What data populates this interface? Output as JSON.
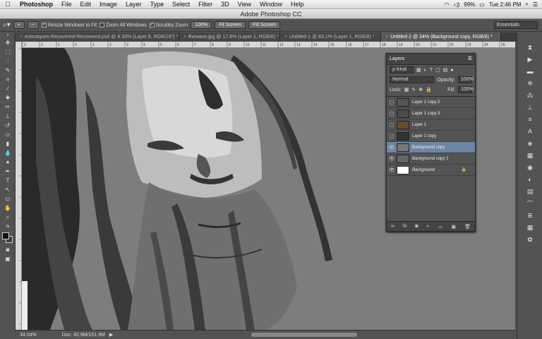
{
  "menubar": {
    "apple": "",
    "app": "Photoshop",
    "items": [
      "File",
      "Edit",
      "Image",
      "Layer",
      "Type",
      "Select",
      "Filter",
      "3D",
      "View",
      "Window",
      "Help"
    ],
    "battery": "99%",
    "clock": "Tue 2:46 PM"
  },
  "window": {
    "title": "Adobe Photoshop CC"
  },
  "options": {
    "resize_label": "Resize Windows to Fit",
    "zoom_all_label": "Zoom All Windows",
    "scrubby_label": "Scrubby Zoom",
    "btn_100": "100%",
    "fit_screen": "Fit Screen",
    "fill_screen": "Fill Screen",
    "workspace": "Essentials"
  },
  "tabs": [
    {
      "label": "estoraques-Recovered-Recovered.psd @ 8.33% (Layer 6, RGB/16*) *"
    },
    {
      "label": "thewave.jpg @ 17.8% (Layer 1, RGB/8) *"
    },
    {
      "label": "Untitled-1 @ 83.1% (Layer 1, RGB/8) *"
    },
    {
      "label": "Untitled-2 @ 34% (Background copy, RGB/8) *"
    }
  ],
  "ruler": {
    "ticks": [
      "3",
      "2",
      "1",
      "0",
      "1",
      "2",
      "3",
      "4",
      "5",
      "6",
      "7",
      "8",
      "9",
      "10",
      "11",
      "12",
      "13",
      "14",
      "15",
      "16",
      "17",
      "18",
      "19",
      "20",
      "21",
      "22",
      "23",
      "24",
      "25"
    ]
  },
  "layers": {
    "title": "Layers",
    "kind": "ρ Kind",
    "blend": "Normal",
    "opacity_label": "Opacity:",
    "opacity": "100%",
    "lock_label": "Lock:",
    "fill_label": "Fill:",
    "fill": "100%",
    "items": [
      {
        "name": "Layer 1 copy 2",
        "visible": false,
        "thumb": "#555"
      },
      {
        "name": "Layer 1 copy 3",
        "visible": false,
        "thumb": "#4a4a4a"
      },
      {
        "name": "Layer 1",
        "visible": false,
        "thumb": "#6b4a2a"
      },
      {
        "name": "Layer 1 copy",
        "visible": false,
        "thumb": "#333"
      },
      {
        "name": "Background copy",
        "visible": true,
        "thumb": "#777",
        "active": true
      },
      {
        "name": "Background copy 2",
        "visible": true,
        "thumb": "#666"
      },
      {
        "name": "Background",
        "visible": true,
        "thumb": "#fff",
        "locked": true
      }
    ]
  },
  "status": {
    "zoom": "34.04%",
    "doc": "Doc: 42.9M/151.9M"
  }
}
